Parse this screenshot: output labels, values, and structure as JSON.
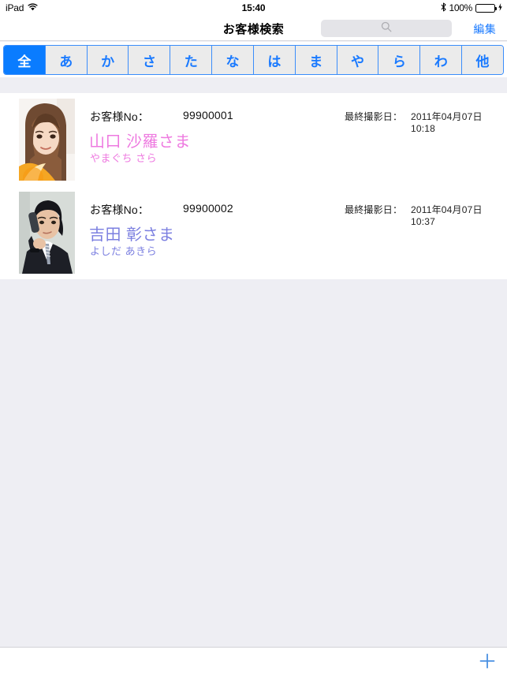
{
  "status_bar": {
    "carrier": "iPad",
    "wifi_icon": "wifi-icon",
    "time": "15:40",
    "bluetooth_icon": "bluetooth-icon",
    "battery_percent": "100%",
    "battery_icon": "battery-full-icon",
    "charging_icon": "lightning-bolt-icon"
  },
  "nav_bar": {
    "title": "お客様検索",
    "search": {
      "icon": "search-icon",
      "value": "",
      "placeholder": ""
    },
    "edit_label": "編集"
  },
  "segmented_control": {
    "selected_index": 0,
    "segments": [
      {
        "label": "全"
      },
      {
        "label": "あ"
      },
      {
        "label": "か"
      },
      {
        "label": "さ"
      },
      {
        "label": "た"
      },
      {
        "label": "な"
      },
      {
        "label": "は"
      },
      {
        "label": "ま"
      },
      {
        "label": "や"
      },
      {
        "label": "ら"
      },
      {
        "label": "わ"
      },
      {
        "label": "他"
      }
    ]
  },
  "list": {
    "no_label": "お客様No：",
    "date_label": "最終撮影日：",
    "rows": [
      {
        "customer_no": "99900001",
        "name": "山口 沙羅さま",
        "kana": "やまぐち さら",
        "last_shot_date": "2011年04月07日 10:18",
        "name_color": "#ee7ae0",
        "thumbnail": "portrait-woman-orange-ball"
      },
      {
        "customer_no": "99900002",
        "name": "吉田 彰さま",
        "kana": "よしだ あきら",
        "last_shot_date": "2011年04月07日 10:37",
        "name_color": "#7b7fe0",
        "thumbnail": "portrait-man-suit-phone"
      }
    ]
  },
  "toolbar": {
    "add_label": "+",
    "add_icon": "plus-icon"
  },
  "colors": {
    "accent_blue": "#0a7cff",
    "link_blue": "#1a7aff",
    "background_grey": "#eeeef3",
    "battery_green": "#4cd964"
  }
}
